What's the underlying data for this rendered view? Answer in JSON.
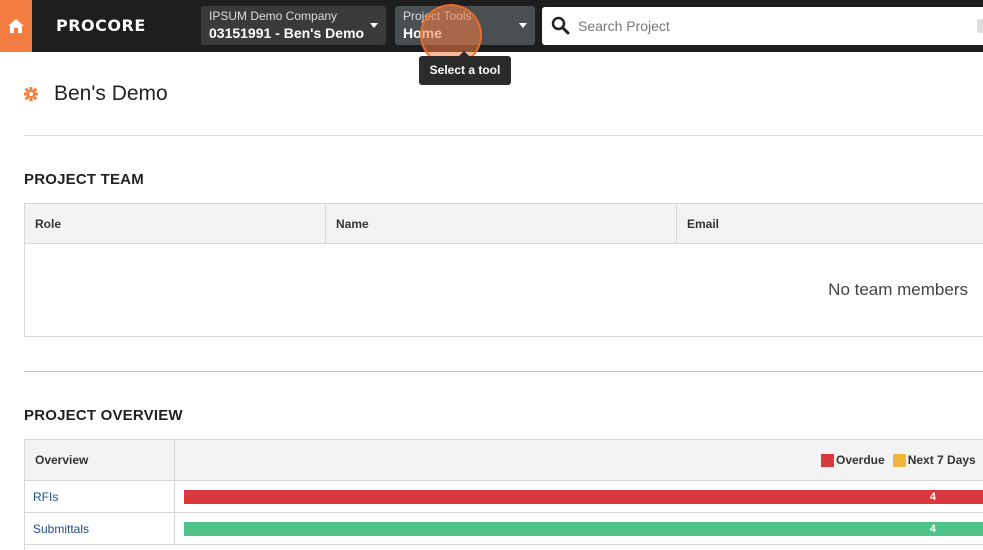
{
  "topbar": {
    "logo": "PROCORE",
    "company": {
      "label": "IPSUM Demo Company",
      "value": "03151991 - Ben's Demo"
    },
    "tools": {
      "label": "Project Tools",
      "value": "Home"
    },
    "search": {
      "placeholder": "Search Project"
    }
  },
  "tooltip": "Select a tool",
  "page": {
    "title": "Ben's Demo"
  },
  "team": {
    "title": "PROJECT TEAM",
    "columns": [
      "Role",
      "Name",
      "Email"
    ],
    "empty_message": "No team members"
  },
  "overview": {
    "title": "PROJECT OVERVIEW",
    "column": "Overview",
    "legend": [
      {
        "label": "Overdue",
        "color": "#d9393c"
      },
      {
        "label": "Next 7 Days",
        "color": "#f0b73c"
      }
    ],
    "rows": [
      {
        "name": "RFIs",
        "count": "4",
        "color": "#d9393c"
      },
      {
        "name": "Submittals",
        "count": "4",
        "color": "#4ec287"
      }
    ]
  },
  "colors": {
    "accent": "#f47e42",
    "nav_bg": "#1e1e1e"
  }
}
